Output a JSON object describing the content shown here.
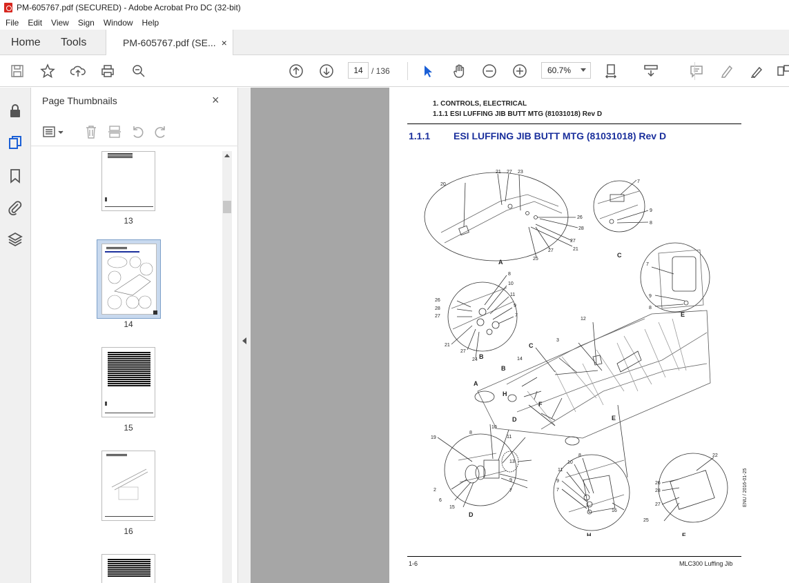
{
  "window": {
    "title": "PM-605767.pdf (SECURED) - Adobe Acrobat Pro DC (32-bit)"
  },
  "menu": {
    "items": [
      "File",
      "Edit",
      "View",
      "Sign",
      "Window",
      "Help"
    ]
  },
  "tabs": {
    "home": "Home",
    "tools": "Tools",
    "doc": "PM-605767.pdf (SE...",
    "close": "×"
  },
  "toolbar": {
    "page_current": "14",
    "page_total": "/ 136",
    "zoom": "60.7%"
  },
  "panel": {
    "title": "Page Thumbnails",
    "close": "×",
    "thumbnails": [
      {
        "label": "13"
      },
      {
        "label": "14"
      },
      {
        "label": "15"
      },
      {
        "label": "16"
      }
    ]
  },
  "page": {
    "header_line1": "1. CONTROLS, ELECTRICAL",
    "header_line2": "1.1.1 ESI LUFFING JIB BUTT MTG (81031018) Rev D",
    "section_number": "1.1.1",
    "section_title": "ESI LUFFING JIB BUTT MTG (81031018) Rev D",
    "footer_left": "1-6",
    "footer_right": "MLC300 Luffing Jib",
    "side_stamp": "ENU / 2016-01-25"
  },
  "diagram": {
    "views": [
      "A",
      "B",
      "C",
      "D",
      "E",
      "F",
      "H"
    ],
    "callouts_A": [
      "20",
      "21",
      "27",
      "23",
      "26",
      "28",
      "27",
      "21",
      "27",
      "25"
    ],
    "callouts_B": [
      "8",
      "10",
      "11",
      "9",
      "7",
      "26",
      "28",
      "27",
      "21",
      "27",
      "24"
    ],
    "callouts_C": [
      "7",
      "9",
      "8"
    ],
    "callouts_E": [
      "7",
      "9",
      "8"
    ],
    "callouts_main": [
      "12",
      "3",
      "14",
      "C",
      "B",
      "A",
      "D",
      "F",
      "E"
    ],
    "callouts_D": [
      "8",
      "10",
      "11",
      "13",
      "19",
      "9",
      "7",
      "2",
      "6",
      "15"
    ],
    "callouts_H": [
      "11",
      "10",
      "8",
      "9",
      "7",
      "16"
    ],
    "callouts_F": [
      "22",
      "26",
      "28",
      "27",
      "25"
    ]
  }
}
